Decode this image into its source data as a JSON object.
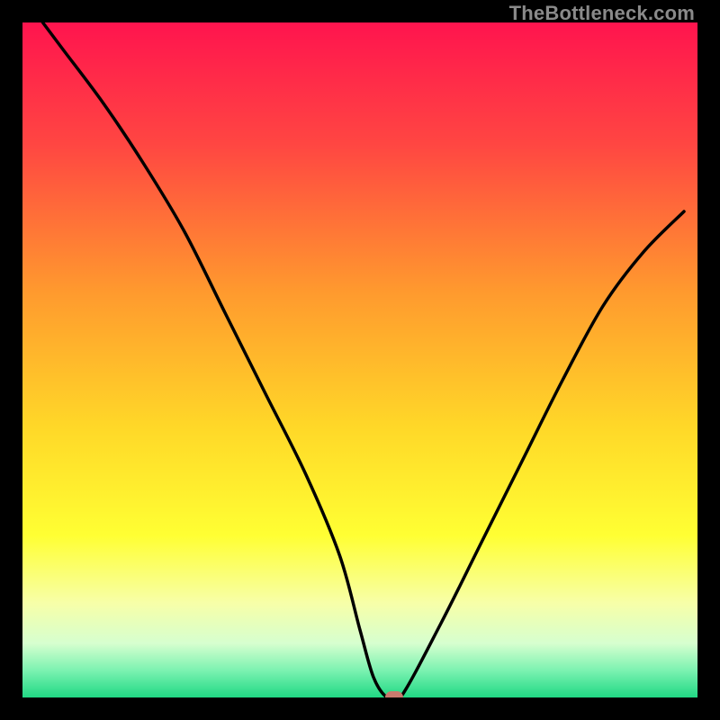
{
  "watermark": "TheBottleneck.com",
  "chart_data": {
    "type": "line",
    "title": "",
    "xlabel": "",
    "ylabel": "",
    "xlim": [
      0,
      100
    ],
    "ylim": [
      0,
      100
    ],
    "gradient_stops": [
      {
        "pct": 0,
        "color": "#ff144e"
      },
      {
        "pct": 18,
        "color": "#ff4642"
      },
      {
        "pct": 40,
        "color": "#ff9a2e"
      },
      {
        "pct": 60,
        "color": "#ffd828"
      },
      {
        "pct": 76,
        "color": "#ffff33"
      },
      {
        "pct": 86,
        "color": "#f7ffa8"
      },
      {
        "pct": 92,
        "color": "#d6ffcf"
      },
      {
        "pct": 96,
        "color": "#7bf2b1"
      },
      {
        "pct": 100,
        "color": "#20d884"
      }
    ],
    "series": [
      {
        "name": "bottleneck-curve",
        "x": [
          3,
          6,
          12,
          18,
          24,
          30,
          36,
          42,
          47,
          50,
          52,
          54,
          56,
          62,
          68,
          74,
          80,
          86,
          92,
          98
        ],
        "y": [
          100,
          96,
          88,
          79,
          69,
          57,
          45,
          33,
          21,
          10,
          3,
          0,
          0,
          11,
          23,
          35,
          47,
          58,
          66,
          72
        ]
      }
    ],
    "marker": {
      "x": 55,
      "y": 0,
      "color": "#c97a6e"
    }
  }
}
